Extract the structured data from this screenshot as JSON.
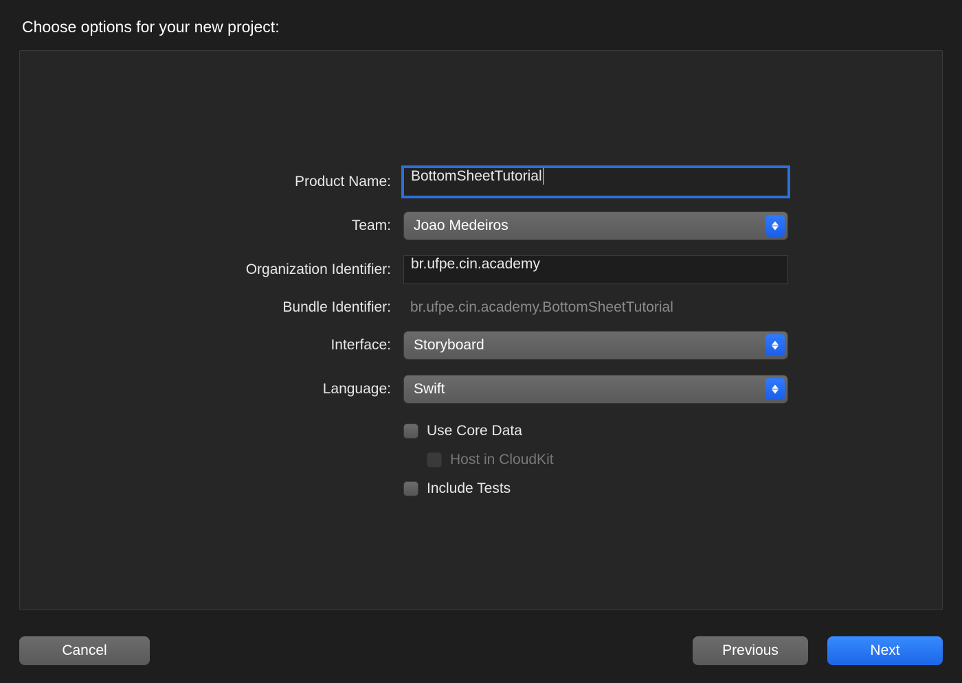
{
  "header": {
    "title": "Choose options for your new project:"
  },
  "form": {
    "product_name": {
      "label": "Product Name:",
      "value": "BottomSheetTutorial"
    },
    "team": {
      "label": "Team:",
      "value": "Joao Medeiros"
    },
    "org_id": {
      "label": "Organization Identifier:",
      "value": "br.ufpe.cin.academy"
    },
    "bundle_id": {
      "label": "Bundle Identifier:",
      "value": "br.ufpe.cin.academy.BottomSheetTutorial"
    },
    "interface": {
      "label": "Interface:",
      "value": "Storyboard"
    },
    "language": {
      "label": "Language:",
      "value": "Swift"
    },
    "use_core_data": {
      "label": "Use Core Data"
    },
    "host_cloudkit": {
      "label": "Host in CloudKit"
    },
    "include_tests": {
      "label": "Include Tests"
    }
  },
  "buttons": {
    "cancel": "Cancel",
    "previous": "Previous",
    "next": "Next"
  }
}
